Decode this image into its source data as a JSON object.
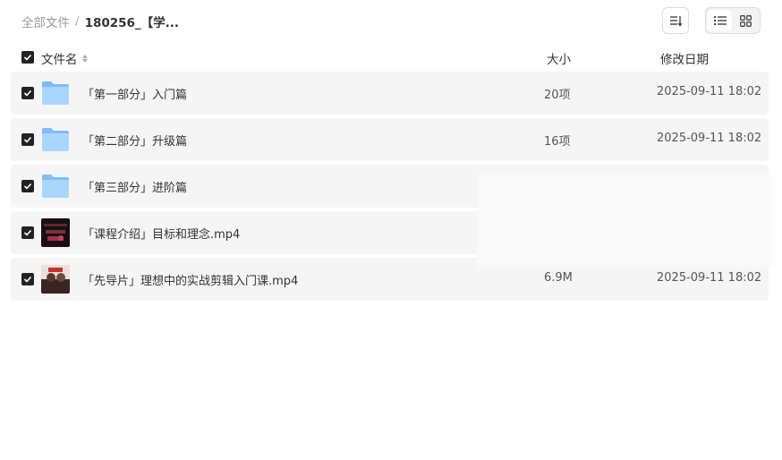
{
  "breadcrumb": {
    "root": "全部文件",
    "separator": "/",
    "current": "180256_【学..."
  },
  "toolbar": {
    "sort_icon": "sort-icon",
    "list_view_icon": "list-view-icon",
    "grid_view_icon": "grid-view-icon",
    "active_view": "list"
  },
  "header": {
    "name": "文件名",
    "size": "大小",
    "date": "修改日期"
  },
  "rows": [
    {
      "name": "「第一部分」入门篇",
      "type": "folder",
      "size": "20项",
      "date": "2025-09-11 18:02",
      "checked": true
    },
    {
      "name": "「第二部分」升级篇",
      "type": "folder",
      "size": "16项",
      "date": "2025-09-11 18:02",
      "checked": true
    },
    {
      "name": "「第三部分」进阶篇",
      "type": "folder",
      "size": "",
      "date": "",
      "checked": true
    },
    {
      "name": "「课程介绍」目标和理念.mp4",
      "type": "video",
      "size": "",
      "date": "",
      "checked": true
    },
    {
      "name": "「先导片」理想中的实战剪辑入门课.mp4",
      "type": "video",
      "size": "6.9M",
      "date": "2025-09-11 18:02",
      "checked": true
    }
  ],
  "colors": {
    "row_bg": "#f5f5f5",
    "folder_light": "#a9d6ff",
    "folder_dark": "#7fbdf6",
    "checkbox": "#222222"
  }
}
